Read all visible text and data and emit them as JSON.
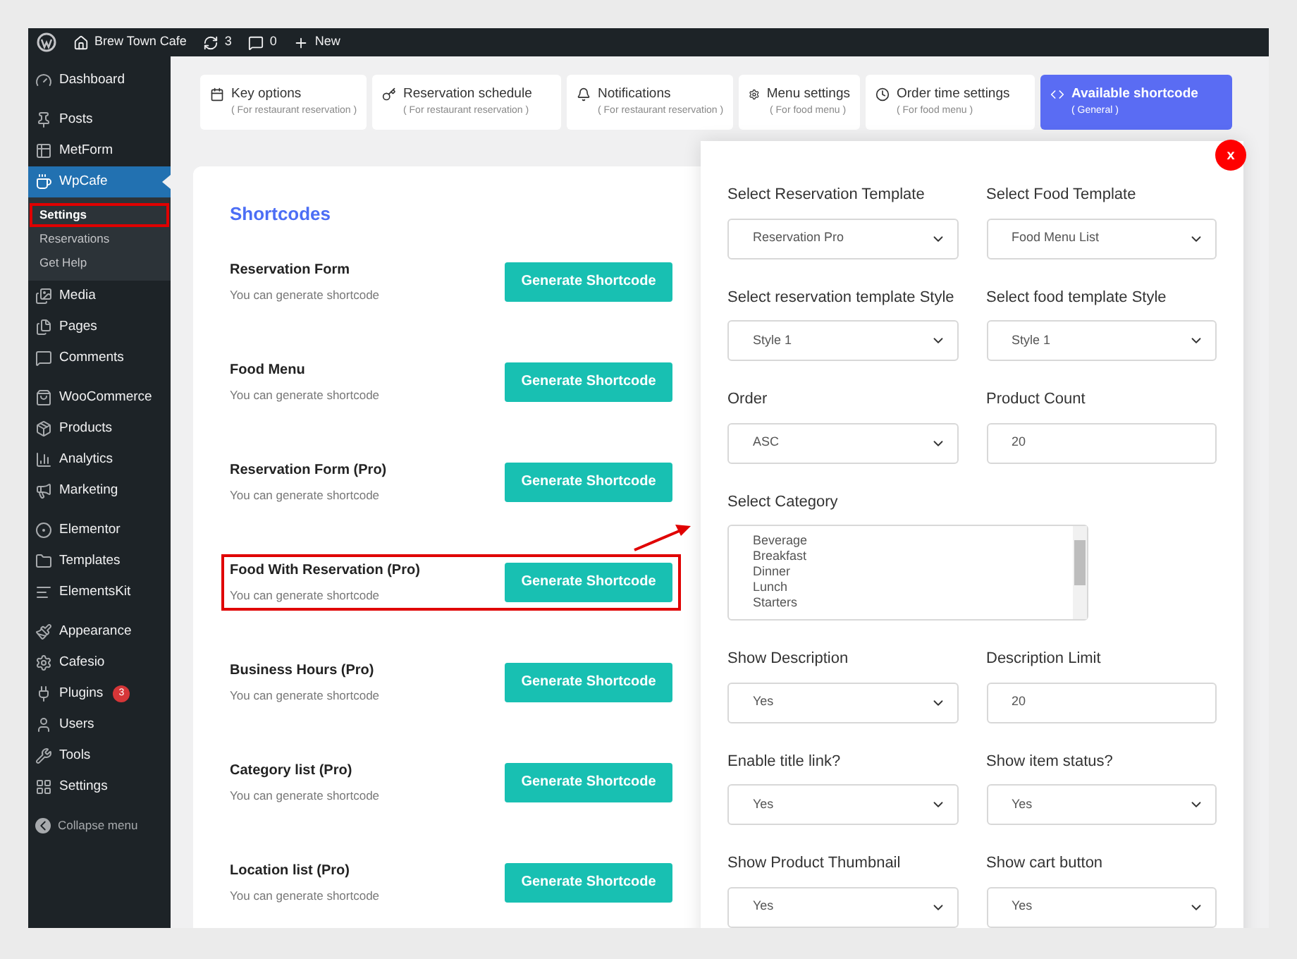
{
  "admin_bar": {
    "site_name": "Brew Town Cafe",
    "updates": "3",
    "comments": "0",
    "new_label": "New"
  },
  "sidebar": {
    "groups": [
      [
        {
          "label": "Dashboard",
          "selected": false
        }
      ],
      [
        {
          "label": "Posts",
          "selected": false
        },
        {
          "label": "MetForm",
          "selected": false
        },
        {
          "label": "WpCafe",
          "selected": true,
          "children": [
            {
              "label": "Settings",
              "selected": true,
              "highlighted": true
            },
            {
              "label": "Reservations",
              "selected": false,
              "highlighted": false
            },
            {
              "label": "Get Help",
              "selected": false,
              "highlighted": false
            }
          ]
        },
        {
          "label": "Media",
          "selected": false
        },
        {
          "label": "Pages",
          "selected": false
        },
        {
          "label": "Comments",
          "selected": false
        }
      ],
      [
        {
          "label": "WooCommerce",
          "selected": false
        },
        {
          "label": "Products",
          "selected": false
        },
        {
          "label": "Analytics",
          "selected": false
        },
        {
          "label": "Marketing",
          "selected": false
        }
      ],
      [
        {
          "label": "Elementor",
          "selected": false
        },
        {
          "label": "Templates",
          "selected": false
        },
        {
          "label": "ElementsKit",
          "selected": false
        }
      ],
      [
        {
          "label": "Appearance",
          "selected": false
        },
        {
          "label": "Cafesio",
          "selected": false
        },
        {
          "label": "Plugins",
          "selected": false,
          "badge": "3"
        },
        {
          "label": "Users",
          "selected": false
        },
        {
          "label": "Tools",
          "selected": false
        },
        {
          "label": "Settings",
          "selected": false
        }
      ]
    ],
    "collapse_label": "Collapse menu"
  },
  "tabs": [
    {
      "label": "Key options",
      "subtitle": "( For restaurant reservation )",
      "selected": false
    },
    {
      "label": "Reservation schedule",
      "subtitle": "( For restaurant reservation )",
      "selected": false
    },
    {
      "label": "Notifications",
      "subtitle": "( For restaurant reservation )",
      "selected": false
    },
    {
      "label": "Menu settings",
      "subtitle": "( For food menu )",
      "selected": false
    },
    {
      "label": "Order time settings",
      "subtitle": "( For food menu )",
      "selected": false
    },
    {
      "label": "Available shortcode",
      "subtitle": "( General )",
      "selected": true
    }
  ],
  "shortcodes": {
    "title": "Shortcodes",
    "items": [
      {
        "title": "Reservation Form",
        "description": "You can generate shortcode",
        "button": "Generate Shortcode",
        "highlighted": false
      },
      {
        "title": "Food Menu",
        "description": "You can generate shortcode",
        "button": "Generate Shortcode",
        "highlighted": false
      },
      {
        "title": "Reservation Form (Pro)",
        "description": "You can generate shortcode",
        "button": "Generate Shortcode",
        "highlighted": false
      },
      {
        "title": "Food With Reservation (Pro)",
        "description": "You can generate shortcode",
        "button": "Generate Shortcode",
        "highlighted": true
      },
      {
        "title": "Business Hours (Pro)",
        "description": "You can generate shortcode",
        "button": "Generate Shortcode",
        "highlighted": false
      },
      {
        "title": "Category list (Pro)",
        "description": "You can generate shortcode",
        "button": "Generate Shortcode",
        "highlighted": false
      },
      {
        "title": "Location list (Pro)",
        "description": "You can generate shortcode",
        "button": "Generate Shortcode",
        "highlighted": false
      }
    ]
  },
  "modal": {
    "close": "x",
    "fields": [
      {
        "kind": "select",
        "label": "Select Reservation Template",
        "value": "Reservation Pro"
      },
      {
        "kind": "select",
        "label": "Select Food Template",
        "value": "Food Menu List"
      },
      {
        "kind": "select",
        "label": "Select reservation template Style",
        "value": "Style 1"
      },
      {
        "kind": "select",
        "label": "Select food template Style",
        "value": "Style 1"
      },
      {
        "kind": "select",
        "label": "Order",
        "value": "ASC"
      },
      {
        "kind": "input",
        "label": "Product Count",
        "value": "20"
      },
      {
        "kind": "listbox",
        "label": "Select Category",
        "options": [
          "Beverage",
          "Breakfast",
          "Dinner",
          "Lunch",
          "Starters"
        ]
      },
      {
        "kind": "select",
        "label": "Show Description",
        "value": "Yes"
      },
      {
        "kind": "input",
        "label": "Description Limit",
        "value": "20"
      },
      {
        "kind": "select",
        "label": "Enable title link?",
        "value": "Yes"
      },
      {
        "kind": "select",
        "label": "Show item status?",
        "value": "Yes"
      },
      {
        "kind": "select",
        "label": "Show Product Thumbnail",
        "value": "Yes"
      },
      {
        "kind": "select",
        "label": "Show cart button",
        "value": "Yes"
      }
    ]
  }
}
